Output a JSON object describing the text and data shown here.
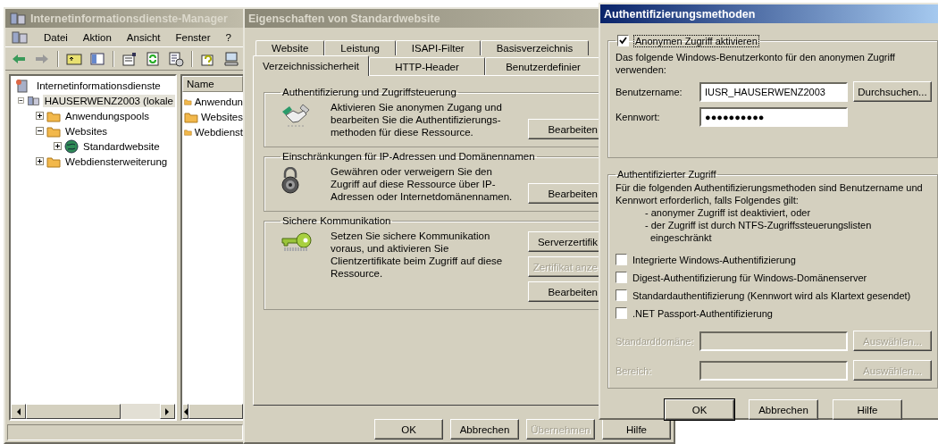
{
  "iis_window": {
    "title": "Internetinformationsdienste-Manager",
    "menu": [
      "Datei",
      "Aktion",
      "Ansicht",
      "Fenster",
      "?"
    ],
    "tree": [
      {
        "label": "Internetinformationsdienste",
        "kind": "root",
        "selected": false,
        "children": [
          {
            "label": "HAUSERWENZ2003 (lokale",
            "kind": "server",
            "expanded": true,
            "selected": true,
            "children": [
              {
                "label": "Anwendungspools",
                "kind": "folder",
                "expanded": false,
                "selected": false
              },
              {
                "label": "Websites",
                "kind": "folder",
                "expanded": true,
                "selected": false,
                "children": [
                  {
                    "label": "Standardwebsite",
                    "kind": "site",
                    "expanded": false,
                    "selected": false
                  }
                ]
              },
              {
                "label": "Webdiensterweiterung",
                "kind": "folder",
                "expanded": false,
                "selected": false
              }
            ]
          }
        ]
      }
    ],
    "list": {
      "column": "Name",
      "items": [
        "Anwendun",
        "Websites",
        "Webdienst"
      ]
    }
  },
  "properties_window": {
    "title": "Eigenschaften von Standardwebsite",
    "tab_rows": [
      [
        {
          "label": "Website",
          "selected": false
        },
        {
          "label": "Leistung",
          "selected": false
        },
        {
          "label": "ISAPI-Filter",
          "selected": false
        },
        {
          "label": "Basisverzeichnis",
          "selected": false
        }
      ],
      [
        {
          "label": "Verzeichnissicherheit",
          "selected": true
        },
        {
          "label": "HTTP-Header",
          "selected": false
        },
        {
          "label": "Benutzerdefinier",
          "selected": false
        }
      ]
    ],
    "groups": [
      {
        "title": "Authentifizierung und Zugriffsteuerung",
        "kind": "authentication",
        "text": "Aktivieren Sie anonymen Zugang und bearbeiten Sie die Authentifizierungs-methoden für diese Ressource.",
        "buttons": [
          {
            "label": "Bearbeiten",
            "disabled": false
          }
        ]
      },
      {
        "title": "Einschränkungen für IP-Adressen und Domänennamen",
        "kind": "ip_restrictions",
        "text": "Gewähren oder verweigern Sie den Zugriff auf diese Ressource über IP-Adressen oder Internetdomänennamen.",
        "buttons": [
          {
            "label": "Bearbeiten",
            "disabled": false
          }
        ]
      },
      {
        "title": "Sichere Kommunikation",
        "kind": "secure_communication",
        "text": "Setzen Sie sichere Kommunikation voraus, und aktivieren Sie Clientzertifikate beim Zugriff auf diese Ressource.",
        "buttons": [
          {
            "label": "Serverzertifik",
            "disabled": false
          },
          {
            "label": "Zertifikat anze",
            "disabled": true
          },
          {
            "label": "Bearbeiten",
            "disabled": false
          }
        ]
      }
    ],
    "buttons": [
      {
        "label": "OK",
        "disabled": false
      },
      {
        "label": "Abbrechen",
        "disabled": false
      },
      {
        "label": "Übernehmen",
        "disabled": true
      },
      {
        "label": "Hilfe",
        "disabled": false
      }
    ]
  },
  "auth_dialog": {
    "title": "Authentifizierungsmethoden",
    "anonymous": {
      "label": "Anonymen Zugriff aktivieren",
      "checked": true,
      "text": "Das folgende Windows-Benutzerkonto für den anonymen Zugriff verwenden:",
      "fields": [
        {
          "label": "Benutzername:",
          "value": "IUSR_HAUSERWENZ2003",
          "button": "Durchsuchen..."
        },
        {
          "label": "Kennwort:",
          "value": "●●●●●●●●●●"
        }
      ]
    },
    "authenticated": {
      "title": "Authentifizierter Zugriff",
      "text": "Für die folgenden Authentifizierungsmethoden sind Benutzername und Kennwort erforderlich, falls Folgendes gilt:",
      "bullets": [
        "- anonymer Zugriff ist deaktiviert, oder",
        "- der Zugriff ist durch NTFS-Zugriffssteuerungslisten eingeschränkt"
      ],
      "options": [
        {
          "label": "Integrierte Windows-Authentifizierung",
          "checked": false
        },
        {
          "label": "Digest-Authentifizierung für Windows-Domänenserver",
          "checked": false
        },
        {
          "label": "Standardauthentifizierung (Kennwort wird als Klartext gesendet)",
          "checked": false
        },
        {
          "label": ".NET Passport-Authentifizierung",
          "checked": false
        }
      ],
      "fields": [
        {
          "label": "Standarddomäne:",
          "button": "Auswählen...",
          "disabled": true
        },
        {
          "label": "Bereich:",
          "button": "Auswählen...",
          "disabled": true
        }
      ]
    },
    "buttons": [
      {
        "label": "OK",
        "default": true
      },
      {
        "label": "Abbrechen",
        "default": false
      },
      {
        "label": "Hilfe",
        "default": false
      }
    ]
  }
}
